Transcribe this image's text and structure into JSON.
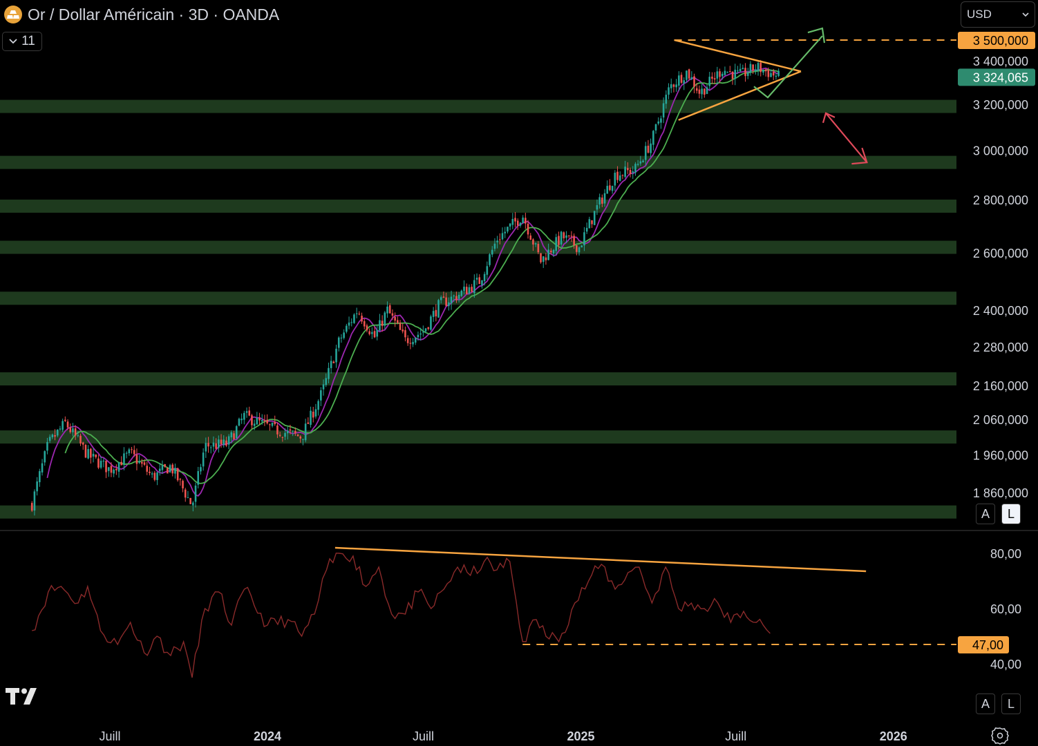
{
  "header": {
    "title": "Or / Dollar Américain · 3D · OANDA",
    "interval_label": "11",
    "currency": "USD"
  },
  "price_scale": {
    "ticks": [
      "3 400,000",
      "3 200,000",
      "3 000,000",
      "2 800,000",
      "2 600,000",
      "2 400,000",
      "2 280,000",
      "2 160,000",
      "2 060,000",
      "1 960,000",
      "1 860,000"
    ],
    "target_label": "3 500,000",
    "current_label": "3 324,065",
    "buttons": {
      "auto": "A",
      "log": "L"
    }
  },
  "rsi_scale": {
    "ticks": [
      "80,00",
      "60,00",
      "40,00"
    ],
    "level_label": "47,00",
    "buttons": {
      "auto": "A",
      "log": "L"
    }
  },
  "time_axis": {
    "labels": [
      "Juill",
      "2024",
      "Juill",
      "2025",
      "Juill",
      "2026"
    ]
  },
  "colors": {
    "up": "#26a69a",
    "down": "#ef5350",
    "ma_fast": "#9c27b0",
    "ma_slow": "#4caf50",
    "zone": "#1e3a1e",
    "annotation": "#f7a440",
    "bull_arrow": "#66bb6a",
    "bear_arrow": "#e04a5a",
    "rsi": "#8a2a2a"
  },
  "chart_data": [
    {
      "type": "candlestick",
      "title": "Or / Dollar Américain · 3D · OANDA",
      "y_scale": "log",
      "ylim": [
        1780,
        3560
      ],
      "x": [
        "2023-04-01",
        "2025-12-31"
      ],
      "x_ticks": [
        "Juill",
        "2024",
        "Juill",
        "2025",
        "Juill",
        "2026"
      ],
      "close_path": [
        [
          "2023-04-01",
          1830
        ],
        [
          "2023-04-20",
          1990
        ],
        [
          "2023-05-10",
          2050
        ],
        [
          "2023-06-05",
          1960
        ],
        [
          "2023-07-01",
          1920
        ],
        [
          "2023-07-25",
          1965
        ],
        [
          "2023-08-20",
          1900
        ],
        [
          "2023-09-10",
          1930
        ],
        [
          "2023-10-05",
          1825
        ],
        [
          "2023-10-20",
          1985
        ],
        [
          "2023-11-15",
          1990
        ],
        [
          "2023-12-05",
          2070
        ],
        [
          "2024-01-10",
          2030
        ],
        [
          "2024-02-10",
          2010
        ],
        [
          "2024-03-05",
          2140
        ],
        [
          "2024-03-25",
          2300
        ],
        [
          "2024-04-15",
          2400
        ],
        [
          "2024-05-05",
          2310
        ],
        [
          "2024-05-20",
          2400
        ],
        [
          "2024-06-10",
          2300
        ],
        [
          "2024-07-01",
          2330
        ],
        [
          "2024-07-20",
          2420
        ],
        [
          "2024-08-10",
          2450
        ],
        [
          "2024-09-05",
          2500
        ],
        [
          "2024-09-25",
          2650
        ],
        [
          "2024-10-25",
          2740
        ],
        [
          "2024-11-15",
          2570
        ],
        [
          "2024-12-10",
          2660
        ],
        [
          "2024-12-30",
          2620
        ],
        [
          "2025-01-20",
          2770
        ],
        [
          "2025-02-10",
          2900
        ],
        [
          "2025-03-05",
          2920
        ],
        [
          "2025-03-25",
          3040
        ],
        [
          "2025-04-15",
          3280
        ],
        [
          "2025-05-05",
          3350
        ],
        [
          "2025-05-20",
          3250
        ],
        [
          "2025-06-15",
          3360
        ],
        [
          "2025-07-05",
          3330
        ],
        [
          "2025-07-25",
          3370
        ],
        [
          "2025-08-20",
          3324
        ]
      ],
      "last_price": 3324.065,
      "target_price": 3500.0,
      "support_zones": [
        3190,
        2950,
        2775,
        2620,
        2440,
        2180,
        2010,
        1810
      ],
      "triangle": {
        "upper_from": [
          "2025-04-20",
          3500
        ],
        "lower_from": [
          "2025-04-25",
          3130
        ],
        "apex": [
          "2025-09-15",
          3350
        ]
      },
      "scenarios": {
        "bull_target": 3520,
        "bear_target": 2950
      }
    },
    {
      "type": "line",
      "title": "",
      "ylim": [
        33,
        85
      ],
      "y_ticks": [
        80,
        60,
        40
      ],
      "level": 47,
      "series": [
        {
          "points": [
            [
              "2023-04-01",
              52
            ],
            [
              "2023-04-20",
              66
            ],
            [
              "2023-05-05",
              68
            ],
            [
              "2023-05-25",
              62
            ],
            [
              "2023-06-05",
              68
            ],
            [
              "2023-06-20",
              52
            ],
            [
              "2023-07-10",
              47
            ],
            [
              "2023-07-25",
              55
            ],
            [
              "2023-08-10",
              44
            ],
            [
              "2023-08-25",
              50
            ],
            [
              "2023-09-10",
              43
            ],
            [
              "2023-09-25",
              48
            ],
            [
              "2023-10-05",
              35
            ],
            [
              "2023-10-20",
              60
            ],
            [
              "2023-11-05",
              66
            ],
            [
              "2023-11-20",
              54
            ],
            [
              "2023-12-05",
              67
            ],
            [
              "2024-01-01",
              54
            ],
            [
              "2024-01-25",
              56
            ],
            [
              "2024-02-10",
              50
            ],
            [
              "2024-02-25",
              58
            ],
            [
              "2024-03-10",
              74
            ],
            [
              "2024-03-25",
              80
            ],
            [
              "2024-04-10",
              79
            ],
            [
              "2024-04-25",
              68
            ],
            [
              "2024-05-10",
              75
            ],
            [
              "2024-05-25",
              58
            ],
            [
              "2024-06-10",
              58
            ],
            [
              "2024-06-25",
              66
            ],
            [
              "2024-07-10",
              60
            ],
            [
              "2024-07-25",
              67
            ],
            [
              "2024-08-10",
              75
            ],
            [
              "2024-08-25",
              72
            ],
            [
              "2024-09-10",
              77
            ],
            [
              "2024-09-25",
              74
            ],
            [
              "2024-10-10",
              77
            ],
            [
              "2024-10-25",
              48
            ],
            [
              "2024-11-10",
              56
            ],
            [
              "2024-11-25",
              49
            ],
            [
              "2024-12-10",
              51
            ],
            [
              "2024-12-25",
              62
            ],
            [
              "2025-01-10",
              70
            ],
            [
              "2025-01-25",
              76
            ],
            [
              "2025-02-10",
              67
            ],
            [
              "2025-02-25",
              73
            ],
            [
              "2025-03-10",
              75
            ],
            [
              "2025-03-25",
              62
            ],
            [
              "2025-04-10",
              75
            ],
            [
              "2025-04-25",
              60
            ],
            [
              "2025-05-10",
              62
            ],
            [
              "2025-05-25",
              60
            ],
            [
              "2025-06-10",
              62
            ],
            [
              "2025-06-25",
              55
            ],
            [
              "2025-07-10",
              59
            ],
            [
              "2025-07-25",
              55
            ],
            [
              "2025-08-10",
              51
            ]
          ]
        }
      ],
      "trendline": [
        [
          "2024-03-20",
          82
        ],
        [
          "2025-11-30",
          73.5
        ]
      ]
    }
  ]
}
